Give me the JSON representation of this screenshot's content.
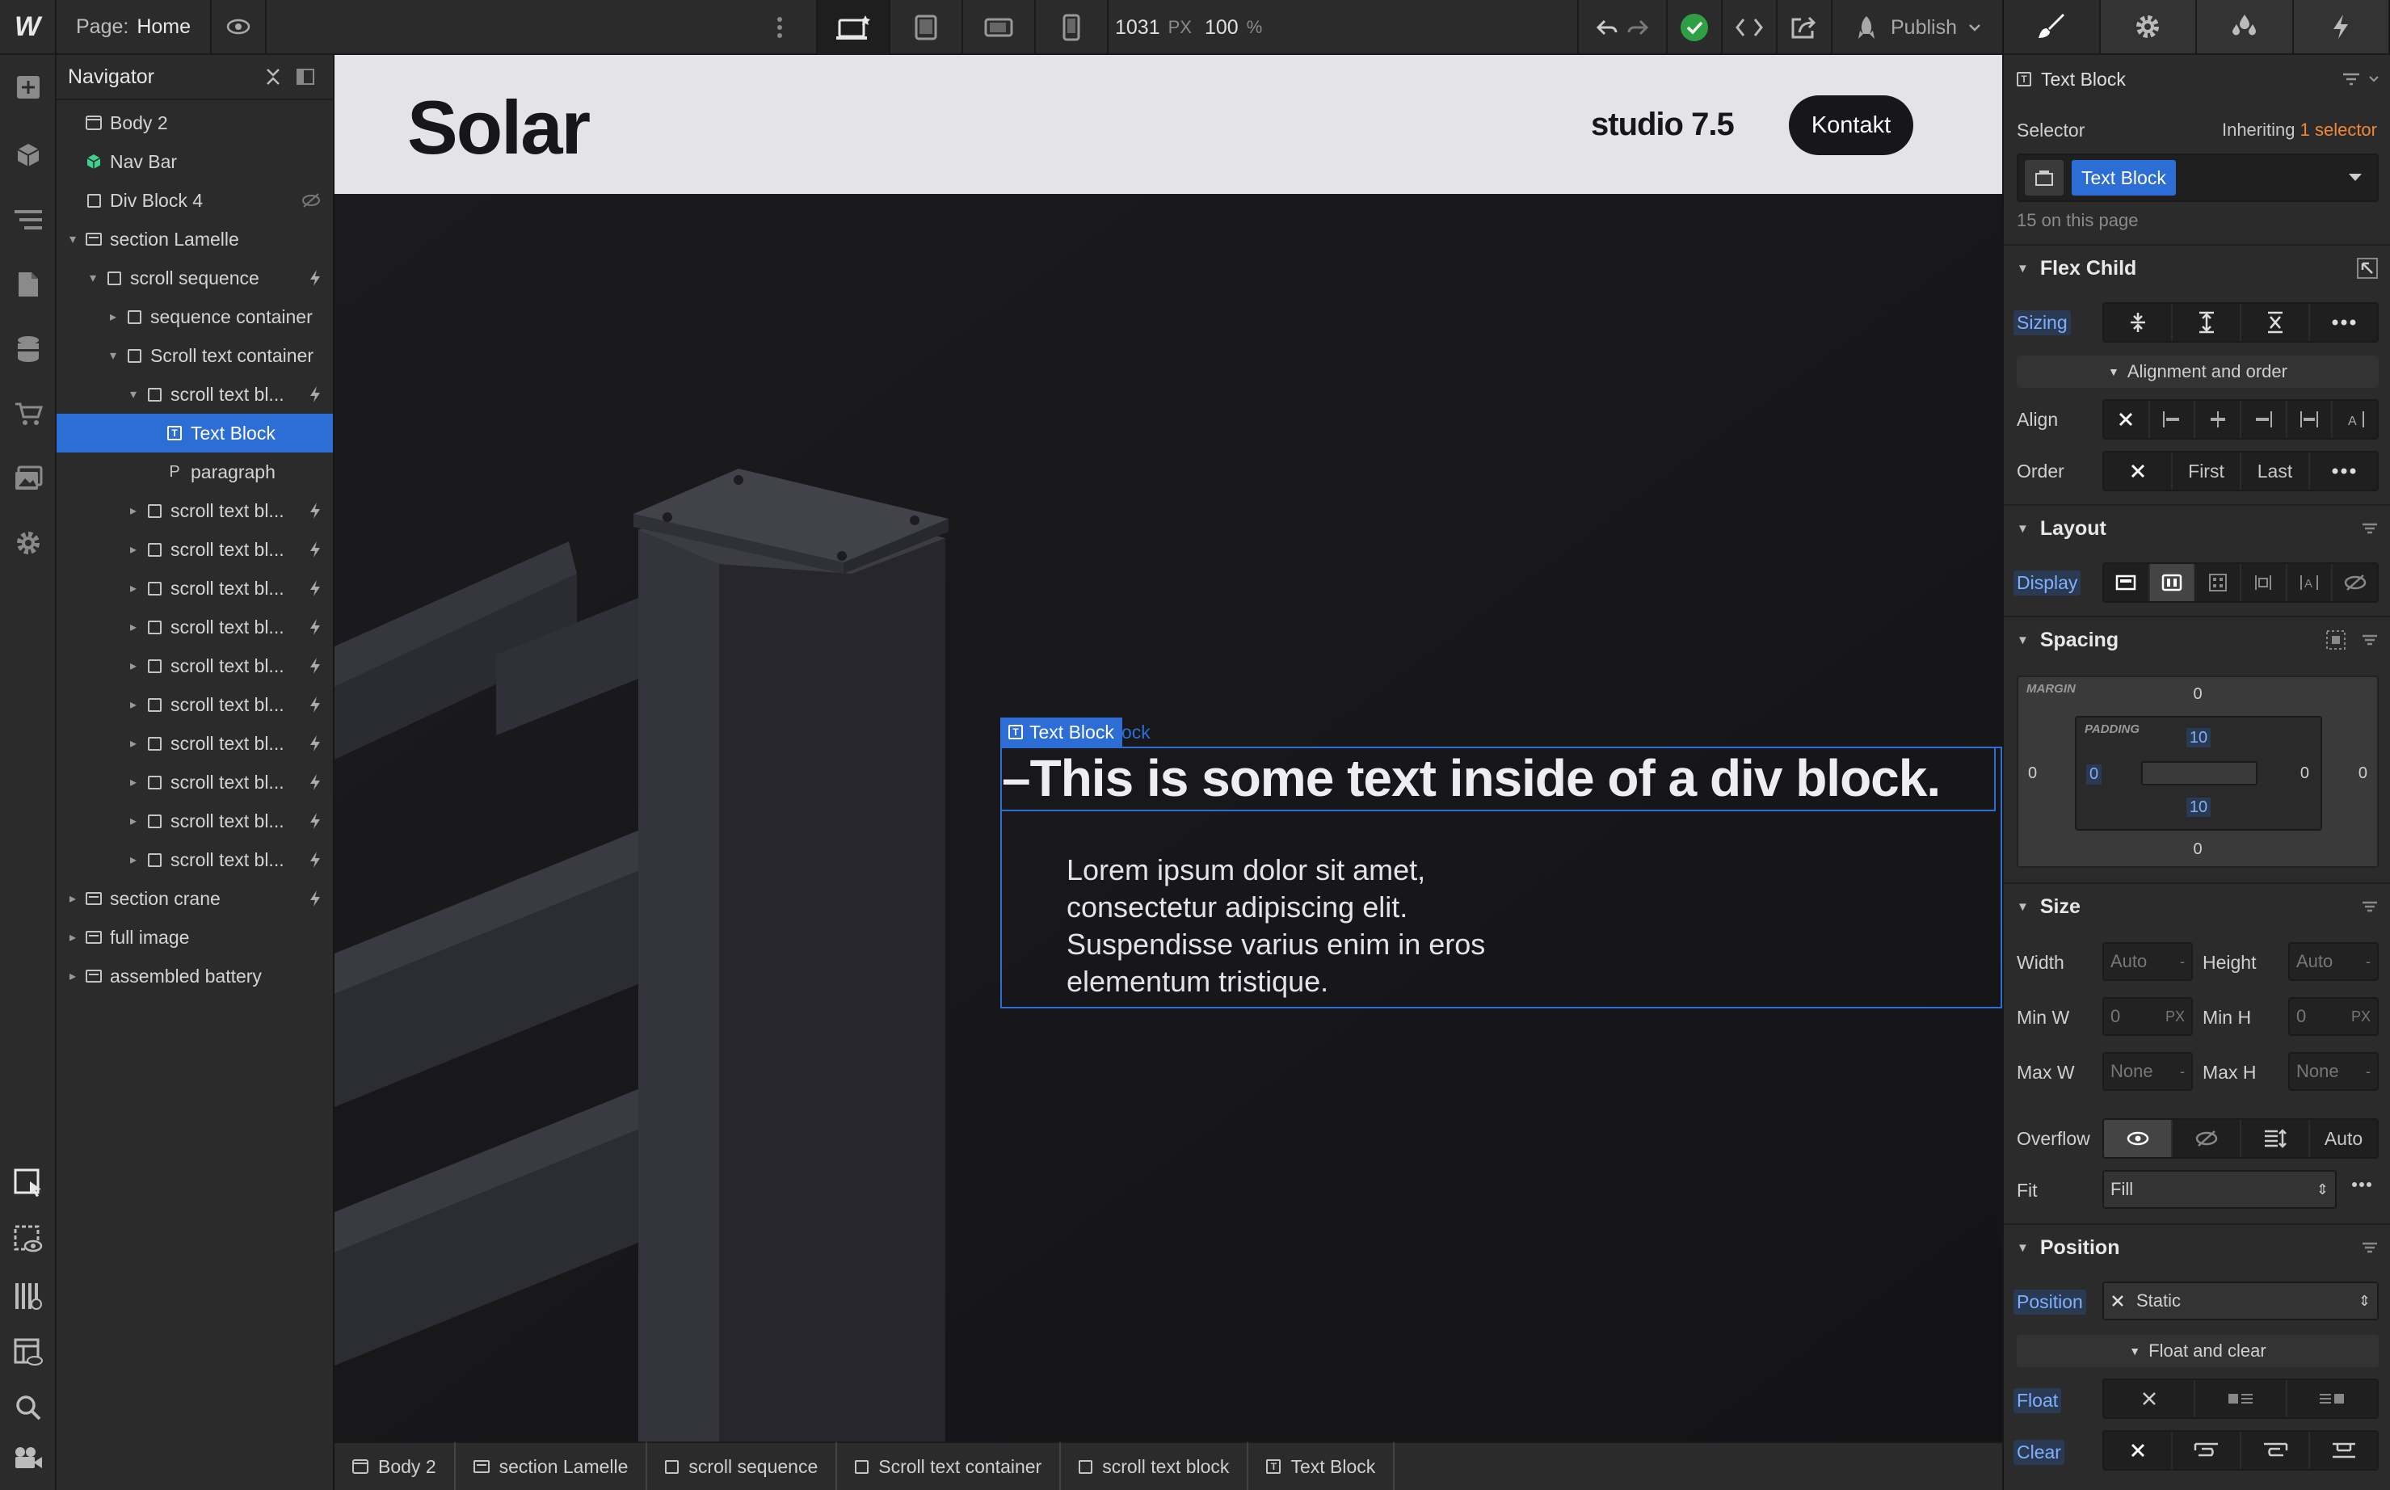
{
  "topbar": {
    "logo": "W",
    "page_label": "Page:",
    "page_name": "Home",
    "width": "1031",
    "width_unit": "PX",
    "zoom": "100",
    "zoom_unit": "%",
    "publish": "Publish"
  },
  "navigator": {
    "title": "Navigator",
    "items": [
      {
        "label": "Body 2"
      },
      {
        "label": "Nav Bar"
      },
      {
        "label": "Div Block 4"
      },
      {
        "label": "section Lamelle"
      },
      {
        "label": "scroll sequence"
      },
      {
        "label": "sequence container"
      },
      {
        "label": "Scroll text container"
      },
      {
        "label": "scroll text bl..."
      },
      {
        "label": "Text Block"
      },
      {
        "label": "paragraph"
      },
      {
        "label": "scroll text bl..."
      },
      {
        "label": "scroll text bl..."
      },
      {
        "label": "scroll text bl..."
      },
      {
        "label": "scroll text bl..."
      },
      {
        "label": "scroll text bl..."
      },
      {
        "label": "scroll text bl..."
      },
      {
        "label": "scroll text bl..."
      },
      {
        "label": "scroll text bl..."
      },
      {
        "label": "scroll text bl..."
      },
      {
        "label": "scroll text bl..."
      },
      {
        "label": "section crane"
      },
      {
        "label": "full image"
      },
      {
        "label": "assembled battery"
      }
    ]
  },
  "canvas": {
    "site_logo": "Solar",
    "site_studio": "studio 7.5",
    "site_button": "Kontakt",
    "selection_label": "Text Block",
    "selection_label_trail": "lock",
    "heading": "–This is some text inside of a div block.",
    "paragraph": "Lorem ipsum dolor sit amet, consectetur adipiscing elit. Suspendisse varius enim in eros elementum tristique."
  },
  "breadcrumbs": [
    "Body 2",
    "section Lamelle",
    "scroll sequence",
    "Scroll text container",
    "scroll text block",
    "Text Block"
  ],
  "panel": {
    "element_name": "Text Block",
    "selector_label": "Selector",
    "inheriting": "Inheriting",
    "inheriting_count": "1 selector",
    "selector_class": "Text Block",
    "on_page": "15 on this page",
    "flex_child": {
      "title": "Flex Child",
      "sizing": "Sizing",
      "alignment_toggle": "Alignment and order",
      "align": "Align",
      "order": "Order",
      "order_first": "First",
      "order_last": "Last"
    },
    "layout": {
      "title": "Layout",
      "display": "Display"
    },
    "spacing": {
      "title": "Spacing",
      "margin_label": "MARGIN",
      "padding_label": "PADDING",
      "margin_top": "0",
      "margin_right": "0",
      "margin_bottom": "0",
      "margin_left": "0",
      "padding_top": "10",
      "padding_right": "0",
      "padding_bottom": "10",
      "padding_left": "0"
    },
    "size": {
      "title": "Size",
      "width": "Width",
      "height": "Height",
      "min_w": "Min W",
      "min_h": "Min H",
      "max_w": "Max W",
      "max_h": "Max H",
      "auto": "Auto",
      "zero": "0",
      "none": "None",
      "px": "PX",
      "dash": "-"
    },
    "overflow": {
      "label": "Overflow",
      "auto": "Auto"
    },
    "fit": {
      "label": "Fit",
      "value": "Fill"
    },
    "position": {
      "title": "Position",
      "label": "Position",
      "value": "Static",
      "float_toggle": "Float and clear",
      "float": "Float",
      "clear": "Clear"
    }
  },
  "colors": {
    "accent": "#2c6ed5",
    "panel_bg": "#2b2b2b",
    "canvas_bg": "#18181c",
    "orange": "#f0883a",
    "green": "#2ea043"
  }
}
